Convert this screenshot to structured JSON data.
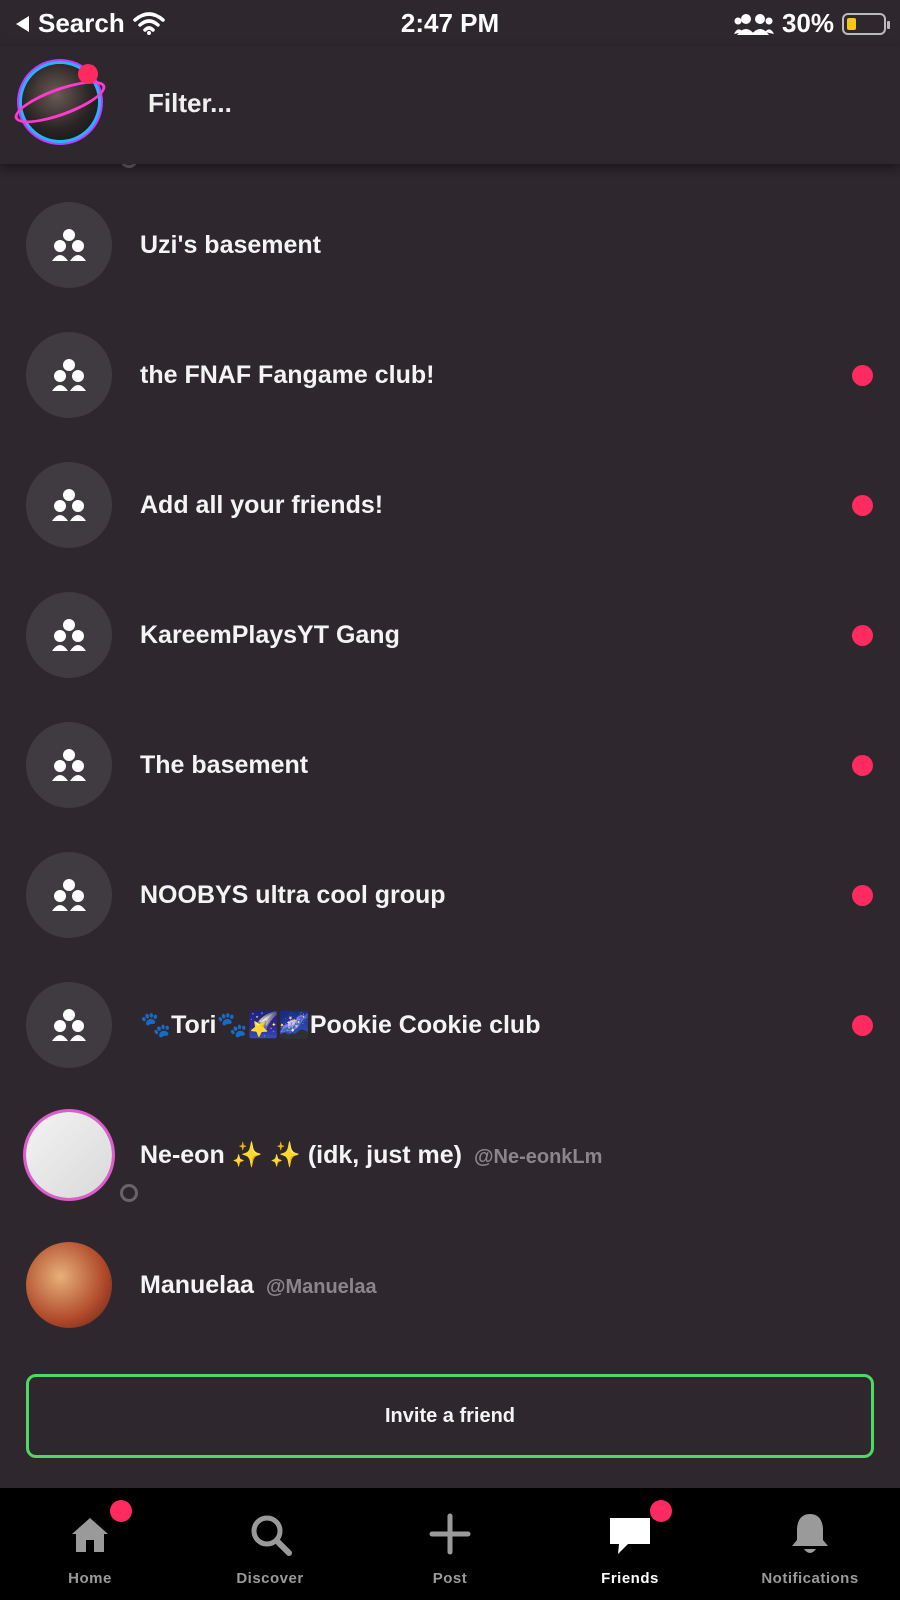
{
  "status_bar": {
    "back_label": "Search",
    "time": "2:47 PM",
    "battery": "30%"
  },
  "header": {
    "filter_placeholder": "Filter..."
  },
  "groups": [
    {
      "name": "Uzi's basement",
      "unread": false
    },
    {
      "name": "the FNAF Fangame club!",
      "unread": true
    },
    {
      "name": "Add all your friends!",
      "unread": true
    },
    {
      "name": "KareemPlaysYT Gang",
      "unread": true
    },
    {
      "name": "The basement",
      "unread": true
    },
    {
      "name": "NOOBYS ultra cool group",
      "unread": true
    },
    {
      "name": "🐾Tori🐾🌠🌌Pookie Cookie club",
      "unread": true
    }
  ],
  "users": [
    {
      "name": "Ne-eon ✨ ✨  (idk, just me)",
      "handle": "@Ne-eonkLm"
    },
    {
      "name": "Manuelaa",
      "handle": "@Manuelaa"
    }
  ],
  "invite_button": "Invite a friend",
  "tabs": [
    {
      "label": "Home",
      "icon": "home-icon",
      "badge": true
    },
    {
      "label": "Discover",
      "icon": "search-icon",
      "badge": false
    },
    {
      "label": "Post",
      "icon": "plus-icon",
      "badge": false
    },
    {
      "label": "Friends",
      "icon": "chat-icon",
      "badge": true,
      "active": true
    },
    {
      "label": "Notifications",
      "icon": "bell-icon",
      "badge": false
    }
  ],
  "colors": {
    "background": "#2e282e",
    "unread_dot": "#ff2a5f",
    "invite_border": "#4cd964"
  }
}
